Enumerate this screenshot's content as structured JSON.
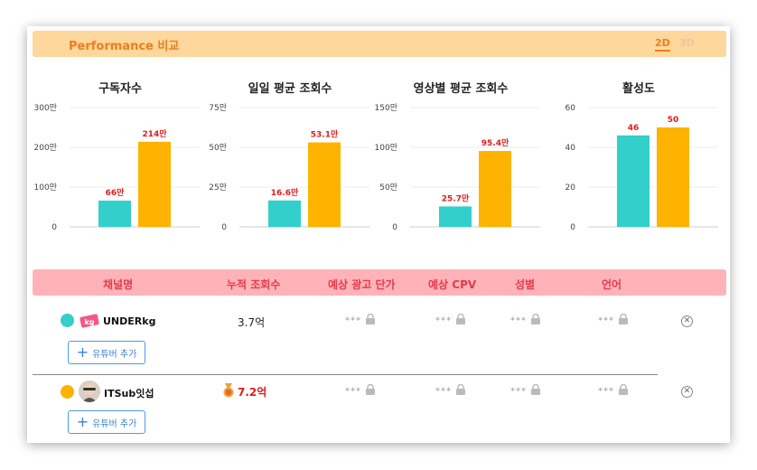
{
  "header": {
    "title": "Performance 비교",
    "toggle_2d": "2D",
    "toggle_3d": "3D"
  },
  "colors": {
    "series_a": "#33cfca",
    "series_b": "#fdb300",
    "label_red": "#e31b1b"
  },
  "chart_data": [
    {
      "type": "bar",
      "title": "구독자수",
      "categories": [
        "UNDERkg",
        "ITSub잇섭"
      ],
      "values": [
        66,
        214
      ],
      "value_labels": [
        "66만",
        "214만"
      ],
      "ylim": [
        0,
        300
      ],
      "yticks": [
        0,
        100,
        200,
        300
      ],
      "ytick_labels": [
        "0",
        "100만",
        "200만",
        "300만"
      ]
    },
    {
      "type": "bar",
      "title": "일일 평균 조회수",
      "categories": [
        "UNDERkg",
        "ITSub잇섭"
      ],
      "values": [
        16.6,
        53.1
      ],
      "value_labels": [
        "16.6만",
        "53.1만"
      ],
      "ylim": [
        0,
        75
      ],
      "yticks": [
        0,
        25,
        50,
        75
      ],
      "ytick_labels": [
        "0",
        "25만",
        "50만",
        "75만"
      ]
    },
    {
      "type": "bar",
      "title": "영상별 평균 조회수",
      "categories": [
        "UNDERkg",
        "ITSub잇섭"
      ],
      "values": [
        25.7,
        95.4
      ],
      "value_labels": [
        "25.7만",
        "95.4만"
      ],
      "ylim": [
        0,
        150
      ],
      "yticks": [
        0,
        50,
        100,
        150
      ],
      "ytick_labels": [
        "0",
        "50만",
        "100만",
        "150만"
      ]
    },
    {
      "type": "bar",
      "title": "활성도",
      "categories": [
        "UNDERkg",
        "ITSub잇섭"
      ],
      "values": [
        46,
        50
      ],
      "value_labels": [
        "46",
        "50"
      ],
      "ylim": [
        0,
        60
      ],
      "yticks": [
        0,
        20,
        40,
        60
      ],
      "ytick_labels": [
        "0",
        "20",
        "40",
        "60"
      ]
    }
  ],
  "table": {
    "headers": [
      "채널명",
      "누적 조회수",
      "예상 광고 단가",
      "예상 CPV",
      "성별",
      "언어"
    ],
    "rows": [
      {
        "channel": "UNDERkg",
        "views": "3.7억",
        "dot_color": "#33cfca",
        "locked": [
          "***",
          "***",
          "***",
          "***"
        ],
        "add_label": "유튜버 추가"
      },
      {
        "channel": "ITSub잇섭",
        "views": "7.2억",
        "dot_color": "#fdb300",
        "locked": [
          "***",
          "***",
          "***",
          "***"
        ],
        "add_label": "유튜버 추가"
      }
    ],
    "icons": {
      "lock": "lock-icon",
      "remove": "close-circle-icon",
      "add": "plus-icon",
      "medal": "medal-icon"
    }
  }
}
